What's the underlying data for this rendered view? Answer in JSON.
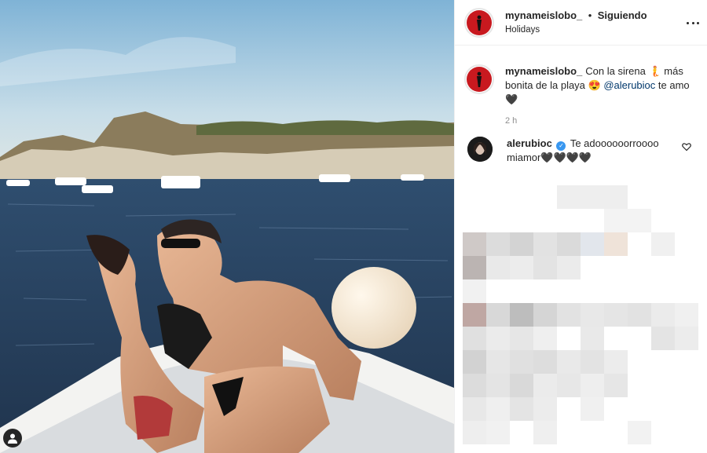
{
  "post": {
    "author": "mynameislobo_",
    "separator": "•",
    "follow_status": "Siguiendo",
    "location": "Holidays",
    "caption_parts": [
      "Con la sirena 🧜 más bonita de la playa 😍 ",
      "@alerubioc",
      " te amo🖤"
    ],
    "time_ago": "2 h",
    "photo_alt": "Pareja besándose en una barca en el mar"
  },
  "comments": [
    {
      "username": "alerubioc",
      "verified": true,
      "text": "Te adoooooorroooo miamor🖤🖤🖤🖤"
    }
  ],
  "icons": {
    "more": "more-options-icon",
    "like": "heart-outline-icon",
    "user_tag": "user-tag-icon",
    "verified": "verified-badge-icon"
  },
  "colors": {
    "username_text": "#262626",
    "mention": "#00376b",
    "timestamp": "#8e8e8e",
    "verified": "#3897f0",
    "avatar_red": "#c8191f"
  }
}
